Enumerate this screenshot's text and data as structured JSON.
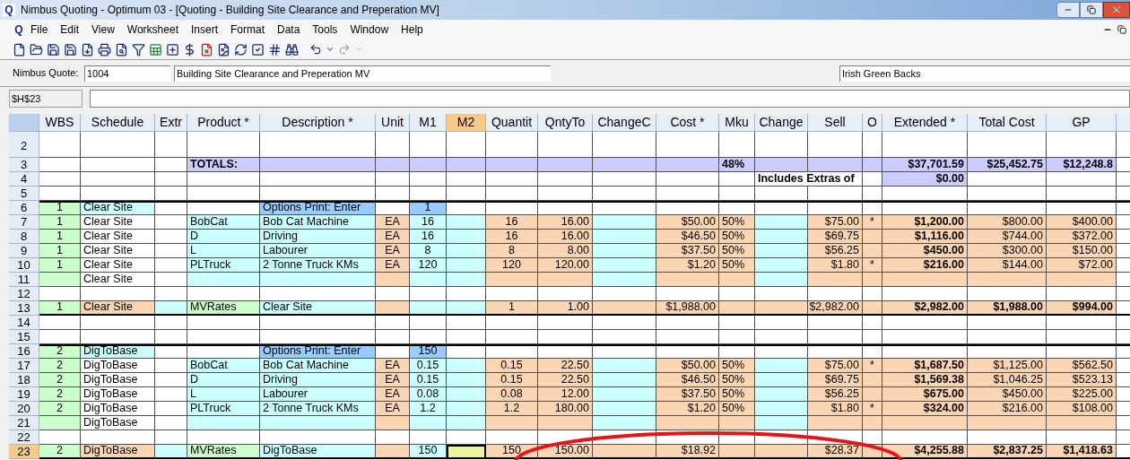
{
  "window": {
    "app_icon": "Q",
    "title": "Nimbus Quoting - Optimum 03 - [Quoting - Building Site Clearance and Preperation MV]"
  },
  "menu_bar": {
    "doc_icon": "Q",
    "items": [
      "File",
      "Edit",
      "View",
      "Worksheet",
      "Insert",
      "Format",
      "Data",
      "Tools",
      "Window",
      "Help"
    ]
  },
  "quote_bar": {
    "label": "Nimbus Quote:",
    "quote_number": "1004",
    "quote_name": "Building Site Clearance and Preperation MV",
    "customer": "Irish Green Backs"
  },
  "formula_bar": {
    "cell_ref": "$H$23"
  },
  "columns": [
    {
      "header": "WBS",
      "selected": false
    },
    {
      "header": "Schedule",
      "selected": false
    },
    {
      "header": "Extr",
      "selected": false
    },
    {
      "header": "Product *",
      "selected": false
    },
    {
      "header": "Description *",
      "selected": false
    },
    {
      "header": "Unit",
      "selected": false
    },
    {
      "header": "M1",
      "selected": false
    },
    {
      "header": "M2",
      "selected": true
    },
    {
      "header": "Quantit",
      "selected": false
    },
    {
      "header": "QntyTo",
      "selected": false
    },
    {
      "header": "ChangeC",
      "selected": false
    },
    {
      "header": "Cost *",
      "selected": false
    },
    {
      "header": "Mku",
      "selected": false
    },
    {
      "header": "Change",
      "selected": false
    },
    {
      "header": "Sell",
      "selected": false
    },
    {
      "header": "O",
      "selected": false
    },
    {
      "header": "Extended *",
      "selected": false
    },
    {
      "header": "Total Cost",
      "selected": false
    },
    {
      "header": "GP",
      "selected": false
    }
  ],
  "rows": [
    {
      "number": "2",
      "kind": "blank",
      "selected": false,
      "cells": {}
    },
    {
      "number": "3",
      "kind": "totals",
      "selected": false,
      "cells": {
        "product": "TOTALS:",
        "mku": "48%",
        "extended": "$37,701.59",
        "total_cost": "$25,452.75",
        "gp": "$12,248.8"
      }
    },
    {
      "number": "4",
      "kind": "extras",
      "selected": false,
      "cells": {
        "change": "Includes Extras of",
        "extended": "$0.00"
      }
    },
    {
      "number": "5",
      "kind": "blank",
      "selected": false,
      "cells": {}
    },
    {
      "number": "6",
      "kind": "group",
      "selected": false,
      "cells": {
        "wbs": "1",
        "schedule": "Clear Site",
        "description": "Options Print: Enter",
        "m1": "1"
      }
    },
    {
      "number": "7",
      "kind": "item",
      "selected": false,
      "cells": {
        "wbs": "1",
        "schedule": "Clear Site",
        "product": "BobCat",
        "description": "Bob Cat Machine",
        "unit": "EA",
        "m1": "16",
        "quantity": "16",
        "qnty_to": "16.00",
        "cost": "$50.00",
        "mku": "50%",
        "sell": "$75.00",
        "o": "*",
        "extended": "$1,200.00",
        "total_cost": "$800.00",
        "gp": "$400.00"
      }
    },
    {
      "number": "8",
      "kind": "item",
      "selected": false,
      "cells": {
        "wbs": "1",
        "schedule": "Clear Site",
        "product": "D",
        "description": "Driving",
        "unit": "EA",
        "m1": "16",
        "quantity": "16",
        "qnty_to": "16.00",
        "cost": "$46.50",
        "mku": "50%",
        "sell": "$69.75",
        "extended": "$1,116.00",
        "total_cost": "$744.00",
        "gp": "$372.00"
      }
    },
    {
      "number": "9",
      "kind": "item",
      "selected": false,
      "cells": {
        "wbs": "1",
        "schedule": "Clear Site",
        "product": "L",
        "description": "Labourer",
        "unit": "EA",
        "m1": "8",
        "quantity": "8",
        "qnty_to": "8.00",
        "cost": "$37.50",
        "mku": "50%",
        "sell": "$56.25",
        "extended": "$450.00",
        "total_cost": "$300.00",
        "gp": "$150.00"
      }
    },
    {
      "number": "10",
      "kind": "item",
      "selected": false,
      "cells": {
        "wbs": "1",
        "schedule": "Clear Site",
        "product": "PLTruck",
        "description": "2 Tonne Truck KMs",
        "unit": "EA",
        "m1": "120",
        "quantity": "120",
        "qnty_to": "120.00",
        "cost": "$1.20",
        "mku": "50%",
        "sell": "$1.80",
        "o": "*",
        "extended": "$216.00",
        "total_cost": "$144.00",
        "gp": "$72.00"
      }
    },
    {
      "number": "11",
      "kind": "group_end",
      "selected": false,
      "cells": {
        "schedule": "Clear Site"
      }
    },
    {
      "number": "12",
      "kind": "blank",
      "selected": false,
      "cells": {}
    },
    {
      "number": "13",
      "kind": "summary",
      "selected": false,
      "cells": {
        "wbs": "1",
        "schedule": "Clear Site",
        "product": "MVRates",
        "description": "Clear Site",
        "quantity": "1",
        "qnty_to": "1.00",
        "cost": "$1,988.00",
        "sell": "$2,982.00",
        "extended": "$2,982.00",
        "total_cost": "$1,988.00",
        "gp": "$994.00"
      }
    },
    {
      "number": "14",
      "kind": "blank",
      "selected": false,
      "cells": {}
    },
    {
      "number": "15",
      "kind": "blank",
      "selected": false,
      "cells": {}
    },
    {
      "number": "16",
      "kind": "group",
      "selected": false,
      "cells": {
        "wbs": "2",
        "schedule": "DigToBase",
        "description": "Options Print: Enter",
        "m1": "150"
      }
    },
    {
      "number": "17",
      "kind": "item",
      "selected": false,
      "cells": {
        "wbs": "2",
        "schedule": "DigToBase",
        "product": "BobCat",
        "description": "Bob Cat Machine",
        "unit": "EA",
        "m1": "0.15",
        "quantity": "0.15",
        "qnty_to": "22.50",
        "cost": "$50.00",
        "mku": "50%",
        "sell": "$75.00",
        "o": "*",
        "extended": "$1,687.50",
        "total_cost": "$1,125.00",
        "gp": "$562.50"
      }
    },
    {
      "number": "18",
      "kind": "item",
      "selected": false,
      "cells": {
        "wbs": "2",
        "schedule": "DigToBase",
        "product": "D",
        "description": "Driving",
        "unit": "EA",
        "m1": "0.15",
        "quantity": "0.15",
        "qnty_to": "22.50",
        "cost": "$46.50",
        "mku": "50%",
        "sell": "$69.75",
        "extended": "$1,569.38",
        "total_cost": "$1,046.25",
        "gp": "$523.13"
      }
    },
    {
      "number": "19",
      "kind": "item",
      "selected": false,
      "cells": {
        "wbs": "2",
        "schedule": "DigToBase",
        "product": "L",
        "description": "Labourer",
        "unit": "EA",
        "m1": "0.08",
        "quantity": "0.08",
        "qnty_to": "12.00",
        "cost": "$37.50",
        "mku": "50%",
        "sell": "$56.25",
        "extended": "$675.00",
        "total_cost": "$450.00",
        "gp": "$225.00"
      }
    },
    {
      "number": "20",
      "kind": "item",
      "selected": false,
      "cells": {
        "wbs": "2",
        "schedule": "DigToBase",
        "product": "PLTruck",
        "description": "2 Tonne Truck KMs",
        "unit": "EA",
        "m1": "1.2",
        "quantity": "1.2",
        "qnty_to": "180.00",
        "cost": "$1.20",
        "mku": "50%",
        "sell": "$1.80",
        "o": "*",
        "extended": "$324.00",
        "total_cost": "$216.00",
        "gp": "$108.00"
      }
    },
    {
      "number": "21",
      "kind": "group_end",
      "selected": false,
      "cells": {
        "schedule": "DigToBase"
      }
    },
    {
      "number": "22",
      "kind": "blank",
      "selected": false,
      "cells": {}
    },
    {
      "number": "23",
      "kind": "summary",
      "selected": true,
      "cells": {
        "wbs": "2",
        "schedule": "DigToBase",
        "product": "MVRates",
        "description": "DigToBase",
        "m1": "150",
        "quantity": "150",
        "qnty_to": "150.00",
        "cost": "$18.92",
        "sell": "$28.37",
        "extended": "$4,255.88",
        "total_cost": "$2,837.25",
        "gp": "$1,418.63"
      }
    }
  ]
}
